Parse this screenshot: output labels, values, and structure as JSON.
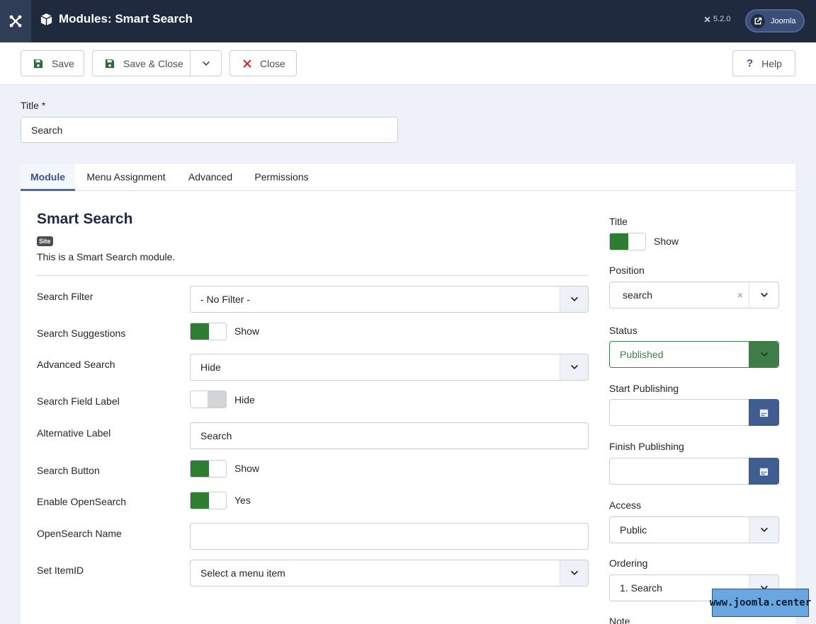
{
  "header": {
    "title": "Modules: Smart Search",
    "version": "5.2.0",
    "user_link_label": "Joomla"
  },
  "toolbar": {
    "save_label": "Save",
    "save_close_label": "Save & Close",
    "close_label": "Close",
    "help_label": "Help"
  },
  "form": {
    "title_label": "Title *",
    "title_value": "Search"
  },
  "tabs": [
    {
      "label": "Module",
      "active": true
    },
    {
      "label": "Menu Assignment",
      "active": false
    },
    {
      "label": "Advanced",
      "active": false
    },
    {
      "label": "Permissions",
      "active": false
    }
  ],
  "module": {
    "heading": "Smart Search",
    "badge": "Site",
    "description": "This is a Smart Search module."
  },
  "fields": {
    "search_filter": {
      "label": "Search Filter",
      "value": "- No Filter -"
    },
    "search_suggestions": {
      "label": "Search Suggestions",
      "state": "Show"
    },
    "advanced_search": {
      "label": "Advanced Search",
      "value": "Hide"
    },
    "search_field_label": {
      "label": "Search Field Label",
      "state": "Hide"
    },
    "alternative_label": {
      "label": "Alternative Label",
      "value": "Search"
    },
    "search_button": {
      "label": "Search Button",
      "state": "Show"
    },
    "enable_opensearch": {
      "label": "Enable OpenSearch",
      "state": "Yes"
    },
    "opensearch_name": {
      "label": "OpenSearch Name",
      "value": ""
    },
    "set_itemid": {
      "label": "Set ItemID",
      "value": "Select a menu item"
    }
  },
  "sidebar": {
    "title": {
      "label": "Title",
      "state": "Show"
    },
    "position": {
      "label": "Position",
      "value": "search",
      "clear": "×"
    },
    "status": {
      "label": "Status",
      "value": "Published"
    },
    "start_publishing": {
      "label": "Start Publishing"
    },
    "finish_publishing": {
      "label": "Finish Publishing"
    },
    "access": {
      "label": "Access",
      "value": "Public"
    },
    "ordering": {
      "label": "Ordering",
      "value": "1. Search"
    },
    "note": {
      "label": "Note"
    }
  },
  "watermark": "www.joomla.center",
  "colors": {
    "header_bg": "#1f2a3f",
    "switch_on": "#2e7d32",
    "status_green": "#3f7d48",
    "calendar_btn": "#3f5e8f",
    "active_tab": "#3b5481"
  }
}
